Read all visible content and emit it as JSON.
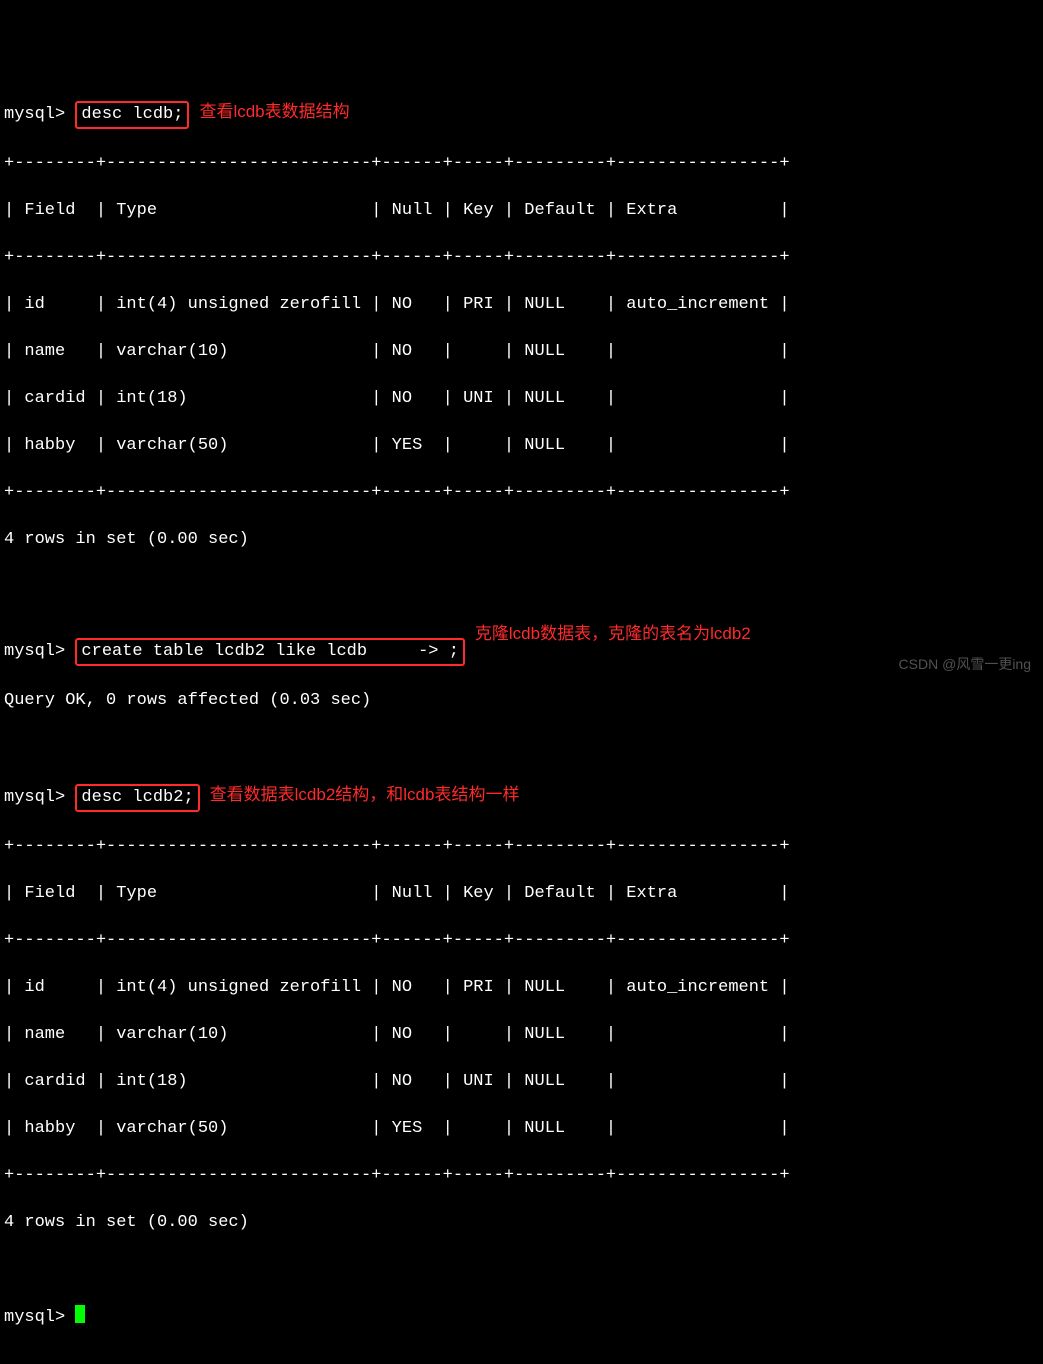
{
  "prompt": "mysql>",
  "cont_prompt": "    ->",
  "cmd1": "desc lcdb;",
  "annot1": "查看lcdb表数据结构",
  "border1": "+--------+--------------------------+------+-----+---------+----------------+",
  "header_line": "| Field  | Type                     | Null | Key | Default | Extra          |",
  "rows": {
    "r0": "| id     | int(4) unsigned zerofill | NO   | PRI | NULL    | auto_increment |",
    "r1": "| name   | varchar(10)              | NO   |     | NULL    |                |",
    "r2": "| cardid | int(18)                  | NO   | UNI | NULL    |                |",
    "r3": "| habby  | varchar(50)              | YES  |     | NULL    |                |"
  },
  "rows_summary": "4 rows in set (0.00 sec)",
  "cmd2a": "create table lcdb2 like lcdb",
  "cmd2b": ";",
  "annot2": "克隆lcdb数据表，克隆的表名为lcdb2",
  "query_ok": "Query OK, 0 rows affected (0.03 sec)",
  "cmd3": "desc lcdb2;",
  "annot3": "查看数据表lcdb2结构，和lcdb表结构一样",
  "watermark": "CSDN @风雪一更ing"
}
